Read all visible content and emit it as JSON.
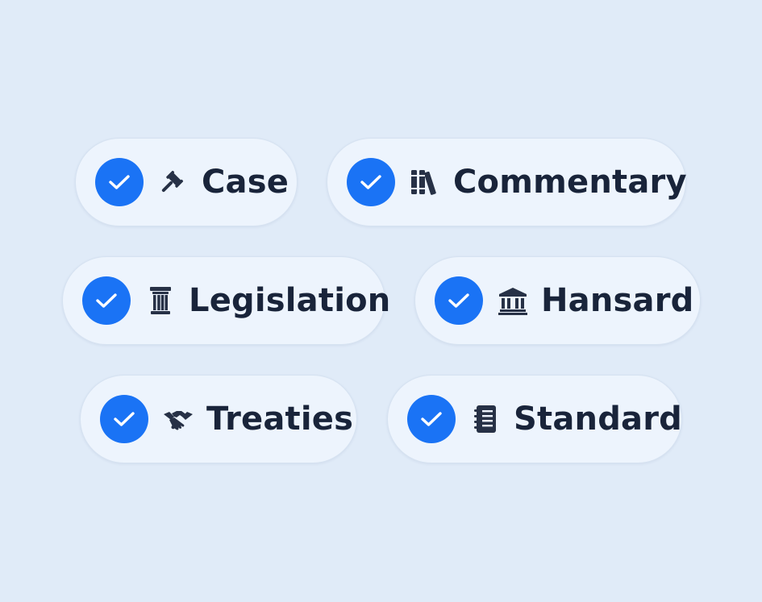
{
  "colors": {
    "background": "#e0ebf8",
    "chip_background": "#edf4fd",
    "check_accent": "#1a73f5",
    "text": "#19243a"
  },
  "filters": [
    {
      "id": "case",
      "label": "Case",
      "icon": "gavel-icon",
      "checked": true
    },
    {
      "id": "commentary",
      "label": "Commentary",
      "icon": "books-icon",
      "checked": true
    },
    {
      "id": "legislation",
      "label": "Legislation",
      "icon": "column-icon",
      "checked": true
    },
    {
      "id": "hansard",
      "label": "Hansard",
      "icon": "landmark-icon",
      "checked": true
    },
    {
      "id": "treaties",
      "label": "Treaties",
      "icon": "handshake-icon",
      "checked": true
    },
    {
      "id": "standard",
      "label": "Standard",
      "icon": "notebook-icon",
      "checked": true
    }
  ]
}
